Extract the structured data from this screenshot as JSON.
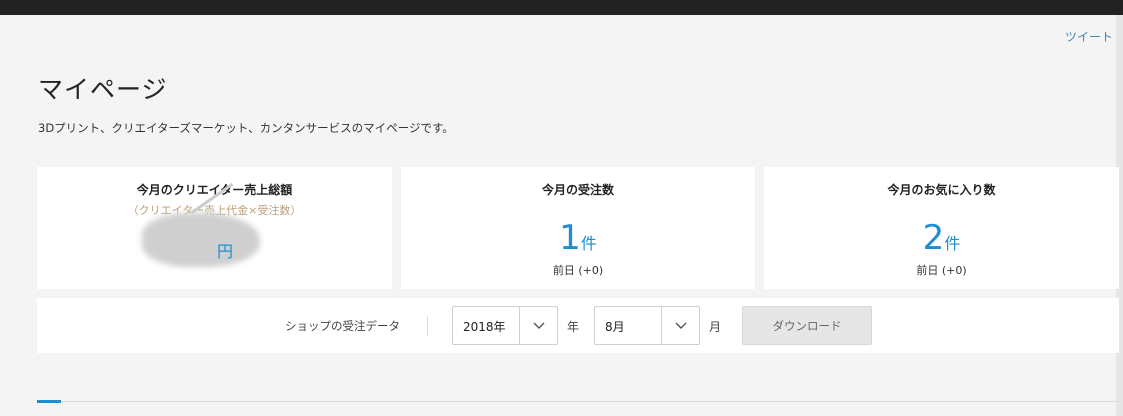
{
  "header": {
    "tweet_label": "ツイート"
  },
  "page": {
    "title": "マイページ",
    "description": "3Dプリント、クリエイターズマーケット、カンタンサービスのマイページです。"
  },
  "stats": [
    {
      "title": "今月のクリエイター売上総額",
      "subtitle": "（クリエイター売上代金×受注数）",
      "value": "",
      "unit": "円",
      "prev": ""
    },
    {
      "title": "今月の受注数",
      "subtitle": "",
      "value": "1",
      "unit": "件",
      "prev": "前日 (+0)"
    },
    {
      "title": "今月のお気に入り数",
      "subtitle": "",
      "value": "2",
      "unit": "件",
      "prev": "前日 (+0)"
    }
  ],
  "download": {
    "label": "ショップの受注データ",
    "year_value": "2018年",
    "year_unit": "年",
    "month_value": "8月",
    "month_unit": "月",
    "button_label": "ダウンロード"
  },
  "colors": {
    "accent": "#1f8ed0",
    "link": "#3e85b9",
    "subtitle": "#b8a27a"
  }
}
